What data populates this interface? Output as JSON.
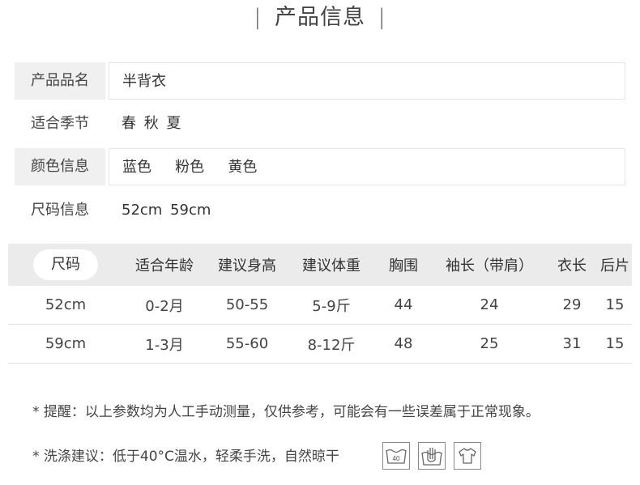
{
  "section": {
    "title": "产品信息",
    "bar_left": "|",
    "bar_right": "|"
  },
  "info": [
    {
      "label": "产品品名",
      "value": "半背衣"
    },
    {
      "label": "适合季节",
      "value": "春 秋 夏"
    },
    {
      "label": "颜色信息",
      "value": "蓝色   粉色   黄色"
    },
    {
      "label": "尺码信息",
      "value": "52cm 59cm"
    }
  ],
  "size_table": {
    "headers": [
      "尺码",
      "适合年龄",
      "建议身高",
      "建议体重",
      "胸围",
      "袖长（带肩）",
      "衣长",
      "后片"
    ],
    "rows": [
      [
        "52cm",
        "0-2月",
        "50-55",
        "5-9斤",
        "44",
        "24",
        "29",
        "15"
      ],
      [
        "59cm",
        "1-3月",
        "55-60",
        "8-12斤",
        "48",
        "25",
        "31",
        "15"
      ]
    ]
  },
  "notes": {
    "reminder": "* 提醒：以上参数均为人工手动测量，仅供参考，可能会有一些误差属于正常现象。",
    "wash": "* 洗涤建议：低于40°C温水，轻柔手洗，自然晾干"
  },
  "care_icons": [
    {
      "icon": "wash-40-icon",
      "text": "40"
    },
    {
      "icon": "hand-wash-icon",
      "text": ""
    },
    {
      "icon": "hang-dry-icon",
      "text": ""
    }
  ],
  "colors": {
    "label_bg": "#f0f0f0",
    "table_header_bg": "#ebebeb",
    "text": "#333333"
  }
}
